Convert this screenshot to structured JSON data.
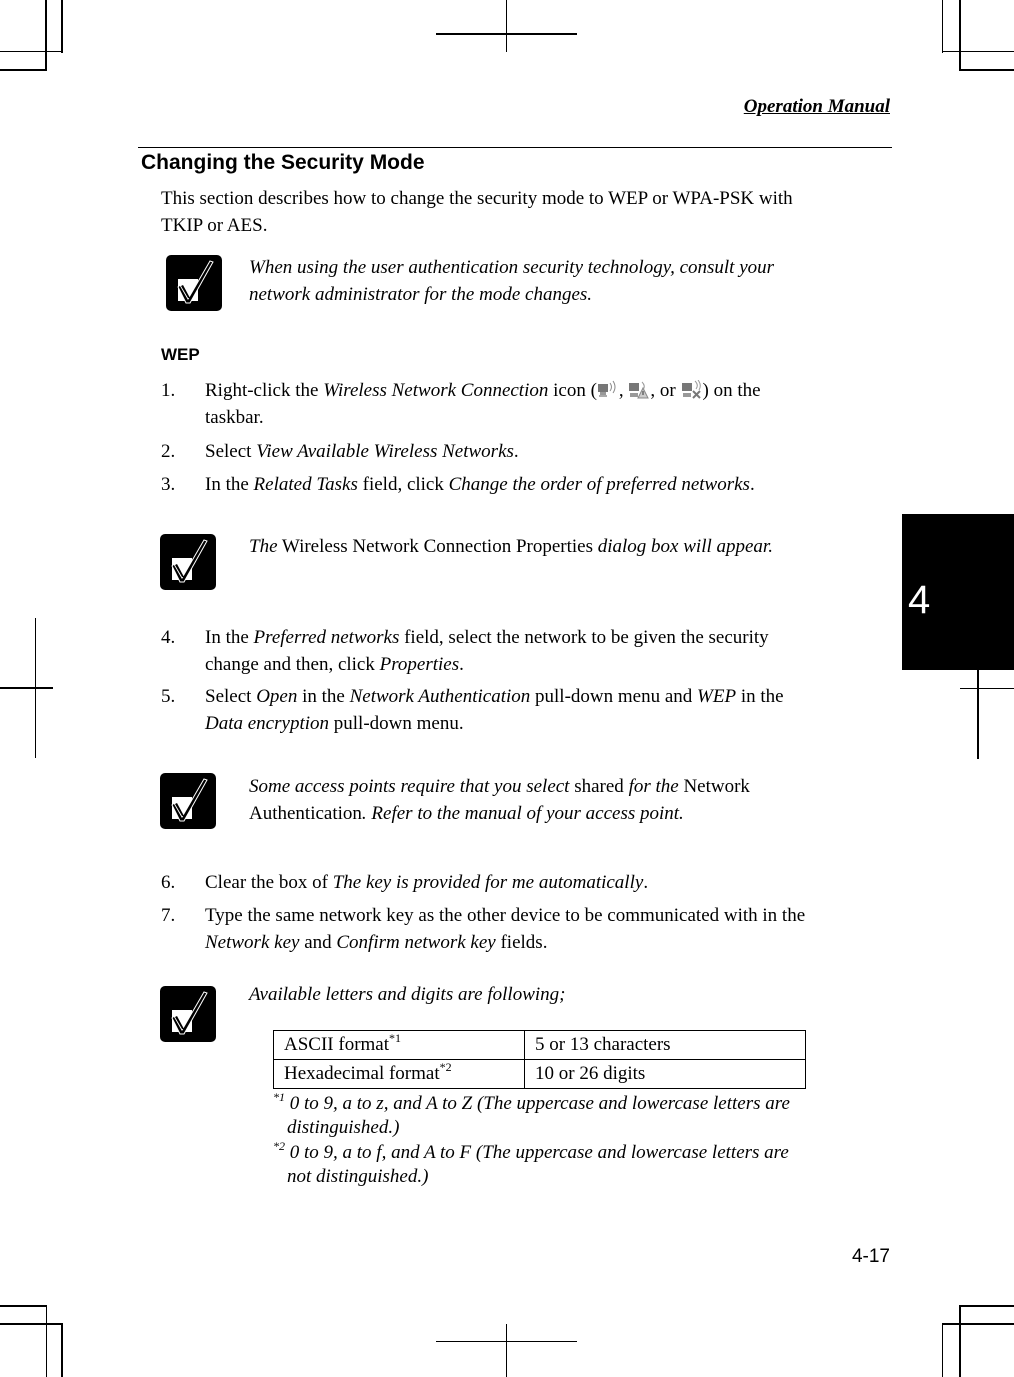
{
  "header": {
    "title": "Operation Manual"
  },
  "section": {
    "title": "Changing the Security Mode",
    "intro_line1": "This section describes how to change the security mode to WEP or WPA-PSK with",
    "intro_line2": "TKIP or AES."
  },
  "notes": [
    {
      "icon": "checkmark-note-icon",
      "line1": "When using the user authentication security technology, consult your",
      "line2": "network administrator for the mode changes."
    },
    {
      "icon": "checkmark-note-icon",
      "italic1": "The",
      "normal1": " Wireless Network Connection Properties ",
      "italic2": "dialog box will appear."
    },
    {
      "icon": "checkmark-note-icon",
      "italic1": "Some access points require that you select ",
      "normal1": "shared",
      "italic2": " for the ",
      "normal2": "Network",
      "normal3": "Authentication",
      "italic3": ". Refer to the manual of your access point."
    },
    {
      "icon": "checkmark-note-icon",
      "line1": "Available letters and digits are following;"
    }
  ],
  "subsection": {
    "title": "WEP"
  },
  "steps": [
    {
      "num": "1.",
      "a": "Right-click the ",
      "b": "Wireless Network Connection",
      "c": " icon (",
      "d": ", ",
      "e": ", or ",
      "f": ") on the",
      "g": "taskbar."
    },
    {
      "num": "2.",
      "a": "Select ",
      "b": "View Available Wireless Networks",
      "c": "."
    },
    {
      "num": "3.",
      "a": "In the ",
      "b": "Related Tasks",
      "c": " field, click ",
      "d": "Change the order of preferred networks",
      "e": "."
    },
    {
      "num": "4.",
      "a": "In the ",
      "b": "Preferred networks",
      "c": " field, select the network to be given the security",
      "d": "change and then, click ",
      "e": "Properties",
      "f": "."
    },
    {
      "num": "5.",
      "a": "Select ",
      "b": "Open",
      "c": " in the ",
      "d": "Network Authentication",
      "e": " pull-down menu and ",
      "f": "WEP",
      "g": " in the",
      "h": "Data encryption",
      "i": " pull-down menu."
    },
    {
      "num": "6.",
      "a": "Clear the box of ",
      "b": "The key is provided for me automatically",
      "c": "."
    },
    {
      "num": "7.",
      "a": "Type the same network key as the other device to be communicated with in the",
      "b": "Network key",
      "c": " and ",
      "d": "Confirm network key",
      "e": " fields."
    }
  ],
  "taskbar_icons": [
    "wireless-connected-icon",
    "wireless-limited-icon",
    "wireless-disconnected-icon"
  ],
  "format_table": {
    "rows": [
      {
        "label": "ASCII format",
        "mark": "*1",
        "value": "5 or 13 characters"
      },
      {
        "label": "Hexadecimal format",
        "mark": "*2",
        "value": "10 or 26 digits"
      }
    ]
  },
  "footnotes": [
    {
      "mark": "*1",
      "line1": " 0 to 9, a to z, and A to Z (The uppercase and lowercase letters are",
      "line2": "distinguished.)"
    },
    {
      "mark": "*2",
      "line1": " 0 to 9, a to f, and A to F (The uppercase and lowercase letters are",
      "line2": "not distinguished.)"
    }
  ],
  "chapter_tab": {
    "label": "4"
  },
  "footer": {
    "page_number": "4-17"
  }
}
